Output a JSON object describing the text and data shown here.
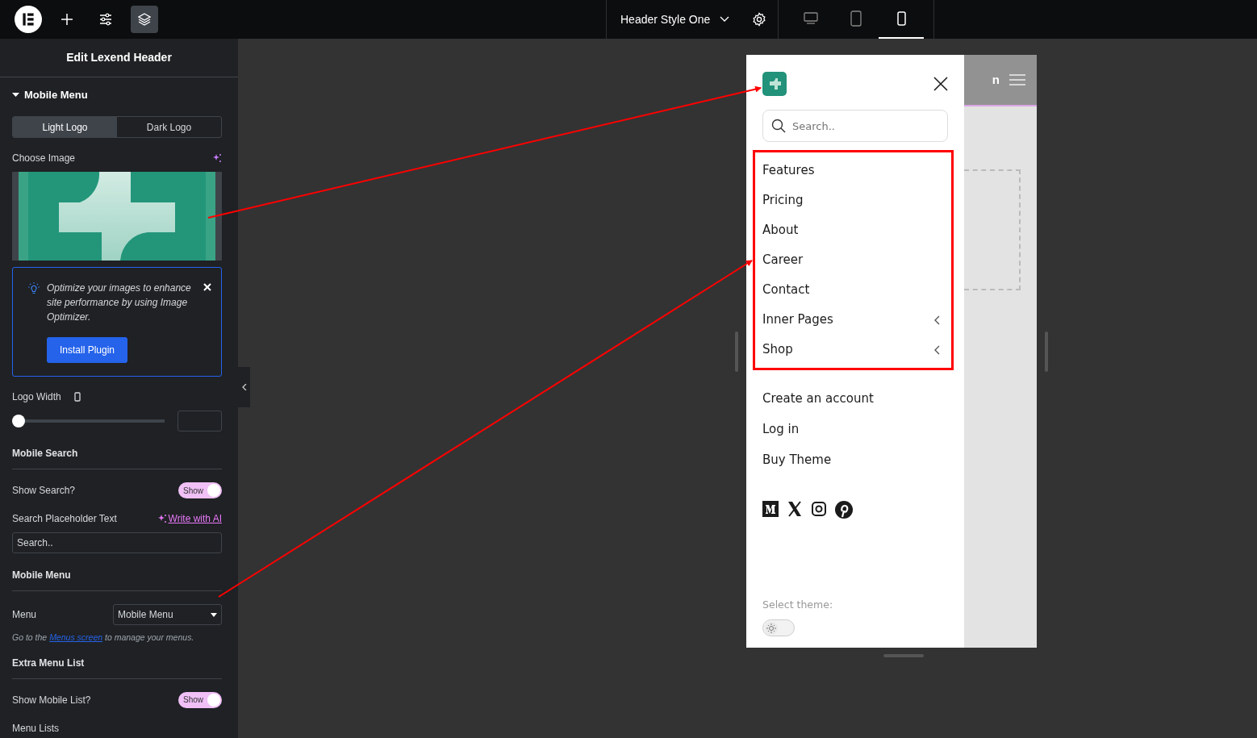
{
  "topbar": {
    "document_title": "Header Style One",
    "devices": [
      {
        "kind": "desktop",
        "selected": false
      },
      {
        "kind": "tablet",
        "selected": false
      },
      {
        "kind": "mobile",
        "selected": true
      }
    ]
  },
  "panel": {
    "title": "Edit Lexend Header",
    "section": "Mobile Menu",
    "section_expanded": true,
    "logo_tabs": [
      {
        "label": "Light Logo",
        "selected": true
      },
      {
        "label": "Dark Logo",
        "selected": false
      }
    ],
    "choose_image_label": "Choose Image",
    "notice": {
      "text": "Optimize your images to enhance site performance by using Image Optimizer.",
      "button": "Install Plugin"
    },
    "logo_width": {
      "label": "Logo Width",
      "level": 0
    },
    "mobile_search": {
      "heading": "Mobile Search",
      "toggle_label": "Show Search?",
      "toggle_text": "Show",
      "on": true,
      "placeholder_label": "Search Placeholder Text",
      "ai_link": "Write with AI",
      "value": "Search.."
    },
    "mobile_menu": {
      "heading": "Mobile Menu",
      "menu_label": "Menu",
      "menu_value": "Mobile Menu",
      "hint_before": "Go to the ",
      "hint_link": "Menus screen",
      "hint_after": " to manage your menus."
    },
    "extra_list": {
      "heading": "Extra Menu List",
      "toggle_label": "Show Mobile List?",
      "toggle_text": "Show",
      "on": true,
      "lists_label": "Menu Lists"
    }
  },
  "preview": {
    "header_partial_text": "n",
    "search_placeholder": "Search..",
    "menu_items": [
      {
        "label": "Features",
        "has_submenu": false
      },
      {
        "label": "Pricing",
        "has_submenu": false
      },
      {
        "label": "About",
        "has_submenu": false
      },
      {
        "label": "Career",
        "has_submenu": false
      },
      {
        "label": "Contact",
        "has_submenu": false
      },
      {
        "label": "Inner Pages",
        "has_submenu": true
      },
      {
        "label": "Shop",
        "has_submenu": true
      }
    ],
    "extra_items": [
      "Create an account",
      "Log in",
      "Buy Theme"
    ],
    "social": [
      {
        "kind": "medium"
      },
      {
        "kind": "x"
      },
      {
        "kind": "instagram"
      },
      {
        "kind": "pinterest"
      }
    ],
    "theme_label": "Select theme:",
    "dark_theme": false
  }
}
